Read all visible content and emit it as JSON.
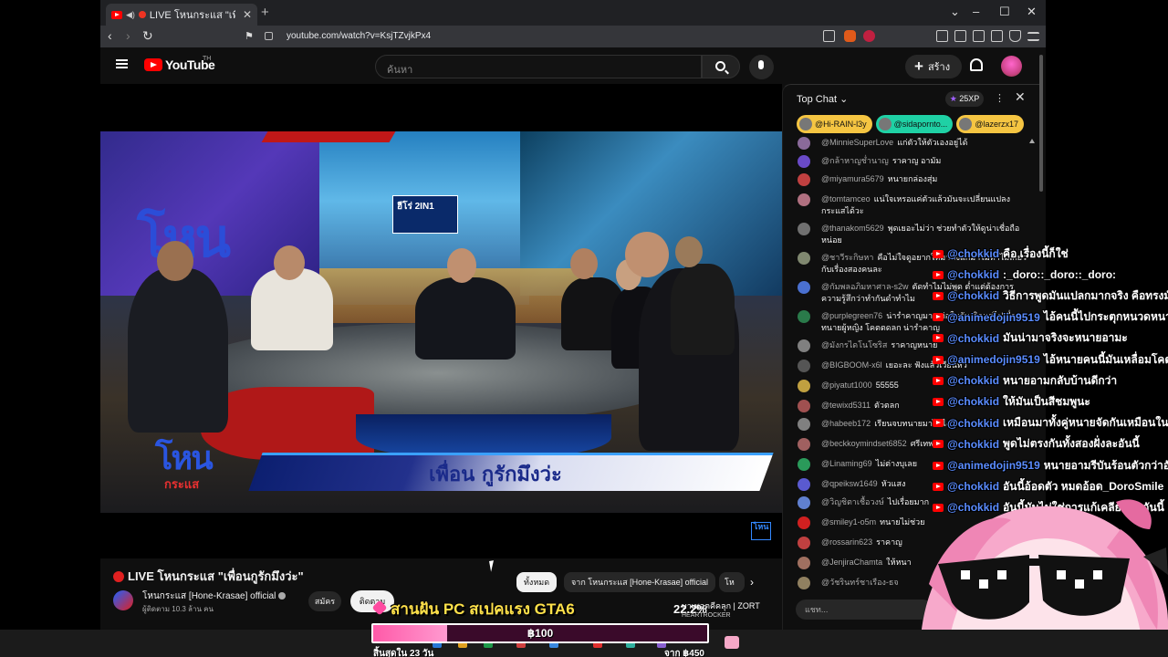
{
  "browser": {
    "tab_title": "LIVE โหนกระแส \"เพื่อนกูรักมึงว่ะ",
    "url": "youtube.com/watch?v=KsjTZvjkPx4",
    "new_tab": "+",
    "win_dropdown": "⌄",
    "win_minimize": "–",
    "win_maximize": "☐",
    "win_close": "✕",
    "back": "‹",
    "forward": "›",
    "reload": "↻",
    "bookmark": "⚑"
  },
  "youtube": {
    "wordmark": "YouTube",
    "region": "TH",
    "search_placeholder": "ค้นหา",
    "create_label": "สร้าง"
  },
  "video": {
    "studio_logo": "โหน",
    "studio_logo_sub": "กระแส",
    "sign_text": "ฮีโร่ 2IN1",
    "lower_third_logo": "โหน",
    "lower_third_sub": "กระแส",
    "lower_third_text": "เพื่อน กูรักมึงว่ะ",
    "corner_logo": "โหน"
  },
  "below_video": {
    "title": "LIVE โหนกระแส \"เพื่อนกูรักมึงว่ะ\"",
    "channel_name": "โหนกระแส [Hone-Krasae] official",
    "subscribers": "ผู้ติดตาม 10.3 ล้าน คน",
    "join_label": "สมัคร",
    "subscribe_label": "ติดตาม",
    "chips": [
      "ทั้งหมด",
      "จาก โหนกระแส [Hone-Krasae] official",
      "โห"
    ]
  },
  "chat": {
    "mode_label": "Top Chat",
    "xp_label": "25XP",
    "pinned": [
      {
        "name": "@Hi-RAIN-l3y",
        "color": "#f5c542"
      },
      {
        "name": "@sidapornto...",
        "color": "#1fd1a5"
      },
      {
        "name": "@lazerzx17",
        "color": "#f5c542"
      }
    ],
    "messages": [
      {
        "name": "@MinnieSuperLove",
        "text": "แก่ตัวให้ตัวเองอยู่ได้",
        "color": "#8a6a9a"
      },
      {
        "name": "@กล้าหาญช่ำนาญ",
        "text": "ราคาญ อามัม",
        "color": "#6a4ac8"
      },
      {
        "name": "@miyamura5679",
        "text": "หนายกล่องสุ่ม",
        "color": "#c04040"
      },
      {
        "name": "@tomtamceo",
        "text": "แน่ใจเหรอแค่ตัวแล้วมันจะเปลี่ยนแปลงกระแสได้วะ",
        "color": "#b07080"
      },
      {
        "name": "@thanakom5629",
        "text": "พูดเยอะไม่ว่า ช่วยทำตัวให้ดูน่าเชื่อถือหน่อย",
        "color": "#707070"
      },
      {
        "name": "@ชาวีระกิษหา",
        "text": "คือไม่ใจดูอยากให้มาฟังแก่มาไม่ทำไม่เกี่ยวกับเรื่องสองคนละ",
        "color": "#808870"
      },
      {
        "name": "@กัมพลอภิมหาศาล-s2w",
        "text": "ตัดทำไมไม่พูด ต่ำแต่ต้องการความรู้สึกว่าทำกันดำทำไม",
        "color": "#4a70d0"
      },
      {
        "name": "@purplegreen76",
        "text": "น่ารำคาญมาก ต่อในวันเกิดแต่ไปเลื่อกทนายผู้หญิง โคตตดลก น่ารำคาญ",
        "color": "#2a7a4a"
      },
      {
        "name": "@มังกรไดโนโซริส",
        "text": "ราคาญหนาย",
        "color": "#808080"
      },
      {
        "name": "@BIGBOOM-x6l",
        "text": "เยอะละ ฟังแล้วเวียนหัว",
        "color": "#555555"
      },
      {
        "name": "@piyatut1000",
        "text": "55555",
        "color": "#c0a040"
      },
      {
        "name": "@tewixd5311",
        "text": "ตัวตลก",
        "color": "#a05050"
      },
      {
        "name": "@habeeb172",
        "text": "เรียนจบทนายมาได้ไง",
        "color": "#808080"
      },
      {
        "name": "@beckkoymindset6852",
        "text": "ศรีเทพ",
        "color": "#a06060"
      },
      {
        "name": "@Linaming69",
        "text": "ไม่ต่างบุเลย",
        "color": "#2a9a5a"
      },
      {
        "name": "@qpeiksw1649",
        "text": "หัวแสง",
        "color": "#5a5ad0"
      },
      {
        "name": "@วิญชิตาเชื้อวงษ์",
        "text": "ไปเรื่อยมาก",
        "color": "#6080d0"
      },
      {
        "name": "@smiley1-o5m",
        "text": "ทนายไม่ช่วย",
        "color": "#d02020"
      },
      {
        "name": "@rossarin623",
        "text": "ราคาญ",
        "color": "#c04040"
      },
      {
        "name": "@JenjiraChamta",
        "text": "ให้หนา",
        "color": "#a07060"
      },
      {
        "name": "@วัชรินทร์ชาเรือง-ธจ",
        "text": "",
        "color": "#908060"
      }
    ],
    "input_placeholder": "แชท..."
  },
  "overlay_chat": [
    {
      "user": "@chokkid",
      "text": "คือ เรื่องนี้ก็ใช่"
    },
    {
      "user": "@chokkid",
      "text": ":_doro::_doro::_doro:"
    },
    {
      "user": "@chokkid",
      "text": "วิธีการพูดมันแปลกมากจริง คือทรงมั"
    },
    {
      "user": "@animedojin9519",
      "text": "ไอ้คนนี้ไปกระตุกหนวดหนา"
    },
    {
      "user": "@chokkid",
      "text": "มันน่ามาจริงจะหนายอามะ"
    },
    {
      "user": "@animedojin9519",
      "text": "ไอ้หนายคนนี้มันเหลื่อมโคต"
    },
    {
      "user": "@chokkid",
      "text": "หนายอามกลับบ้านดีกว่า"
    },
    {
      "user": "@chokkid",
      "text": "ให้มันเป็นสีชมพูนะ"
    },
    {
      "user": "@chokkid",
      "text": "เหมือนมาทั้งคู่หนายจัดกันเหมือนใน"
    },
    {
      "user": "@chokkid",
      "text": "พูดไม่ตรงกันทั้งสองฝั่งละอันนี้"
    },
    {
      "user": "@animedojin9519",
      "text": "หนายอามรีบันร้อนตัวกว่าอั"
    },
    {
      "user": "@chokkid",
      "text": "อันนี้อ้อดตัว หมดอ้อด_DoroSmile"
    },
    {
      "user": "@chokkid",
      "text": "อันนี้มันไม่ใช่การแก้เคลียร์ละ อันนี้"
    }
  ],
  "stream_alert": {
    "headline": "สานฝัน PC สเปคแรง GTA6",
    "percent": "22.2%",
    "sponsor": "บาเพอตคีคลุก | ZORT",
    "sponsor_sub": "HEARTROCKER",
    "amount": "฿100",
    "remaining": "สิ้นสุดใน 23 วัน",
    "target": "จาก ฿450",
    "progress_fraction": 0.222
  },
  "colors": {
    "accent_red": "#ff0000",
    "overlay_user": "#5a8cff",
    "donation_pink": "#ff5aa8"
  }
}
